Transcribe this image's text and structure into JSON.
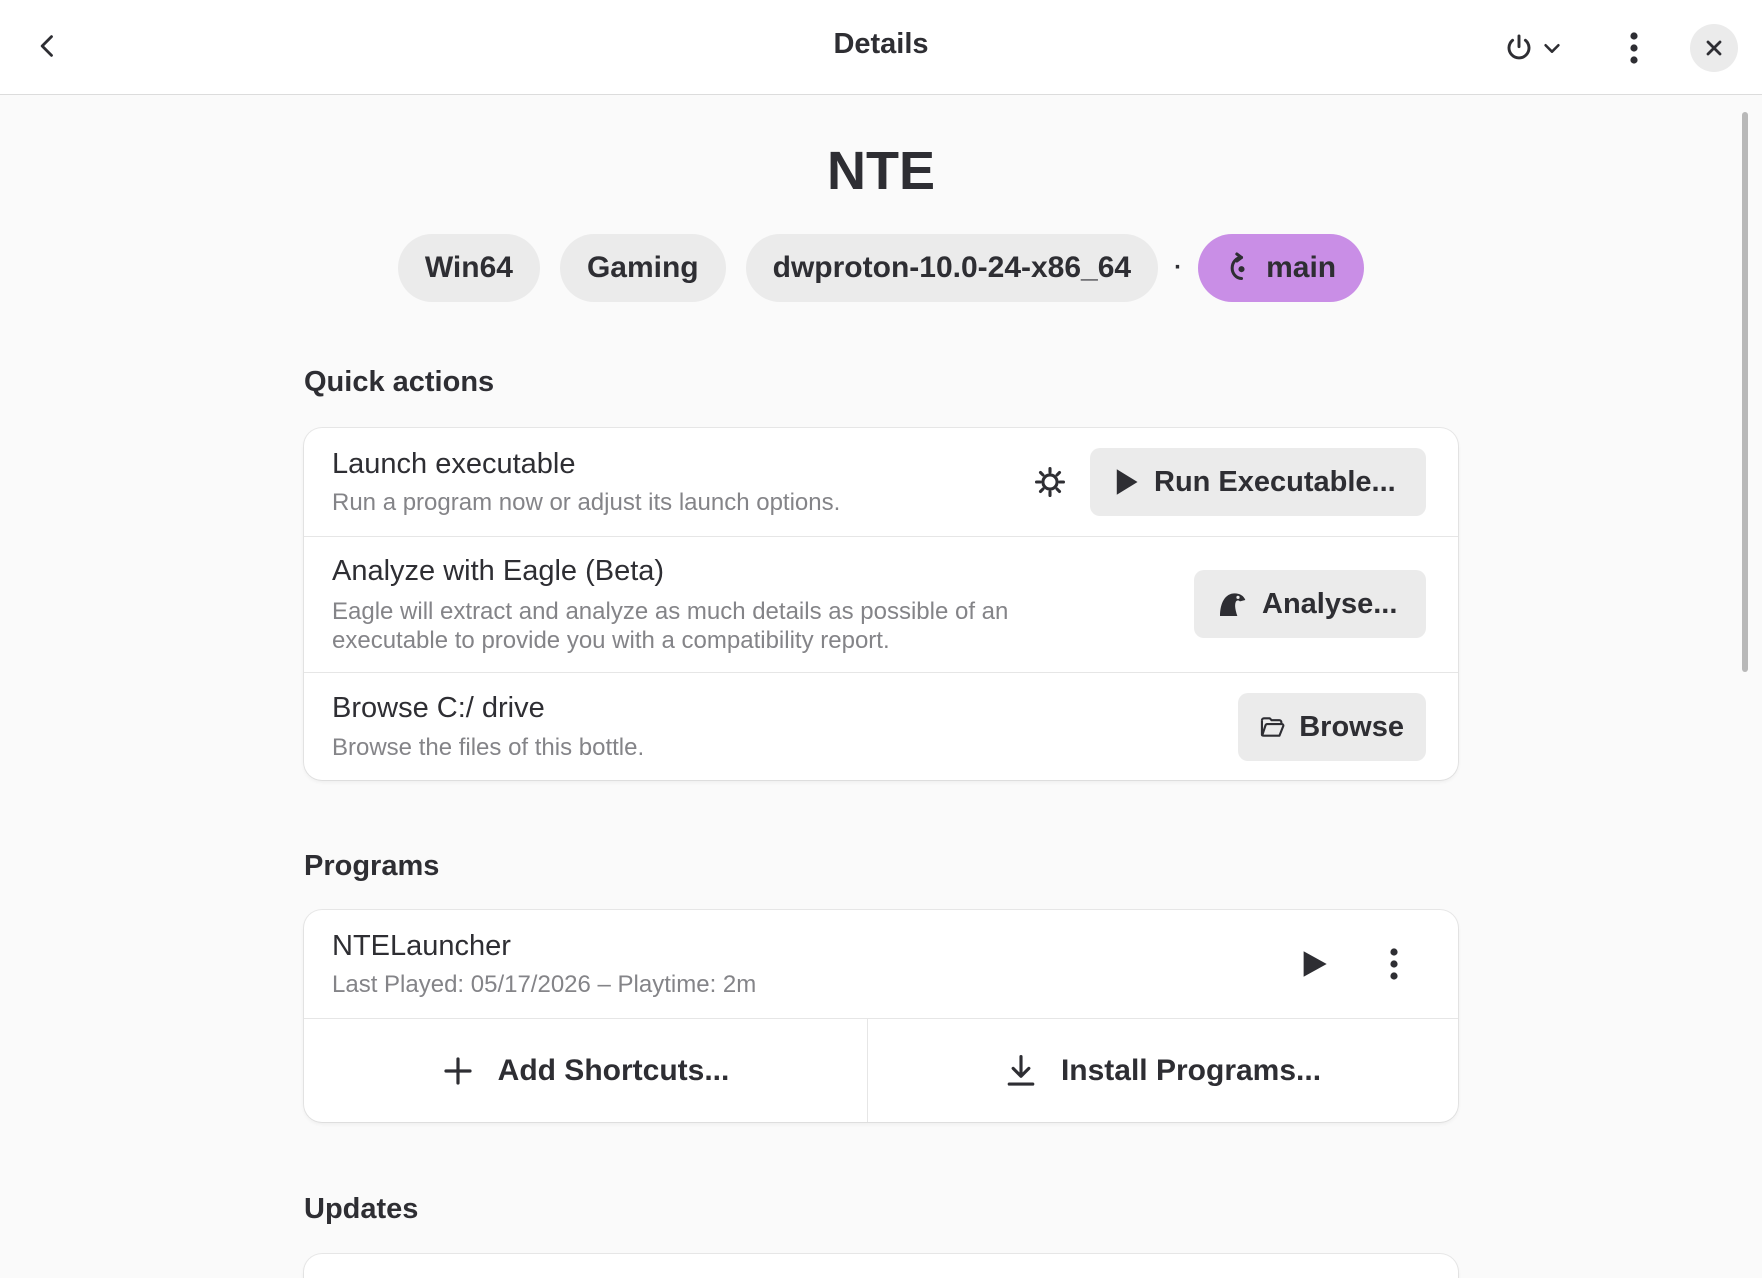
{
  "header": {
    "title": "Details",
    "back_icon": "chevron-left-icon",
    "power_icon": "power-icon",
    "dropdown_icon": "chevron-down-icon",
    "menu_icon": "vertical-dots-icon",
    "close_icon": "close-icon"
  },
  "bottle": {
    "name": "NTE",
    "chips": {
      "arch": "Win64",
      "environment": "Gaming",
      "runner": "dwproton-10.0-24-x86_64",
      "separator": "·",
      "branch": "main"
    },
    "branch_color": "#c98ee6"
  },
  "quick_actions": {
    "heading": "Quick actions",
    "launch": {
      "title": "Launch executable",
      "subtitle": "Run a program now or adjust its launch options.",
      "button": "Run Executable..."
    },
    "eagle": {
      "title": "Analyze with Eagle (Beta)",
      "subtitle_line1": "Eagle will extract and analyze as much details as possible of an",
      "subtitle_line2": "executable to provide you with a compatibility report.",
      "button": "Analyse..."
    },
    "browse": {
      "title": "Browse C:/ drive",
      "subtitle": "Browse the files of this bottle.",
      "button": "Browse"
    }
  },
  "programs": {
    "heading": "Programs",
    "items": [
      {
        "name": "NTELauncher",
        "details": "Last Played: 05/17/2026 – Playtime: 2m"
      }
    ],
    "add_shortcuts": "Add Shortcuts...",
    "install_programs": "Install Programs..."
  },
  "updates": {
    "heading": "Updates"
  }
}
